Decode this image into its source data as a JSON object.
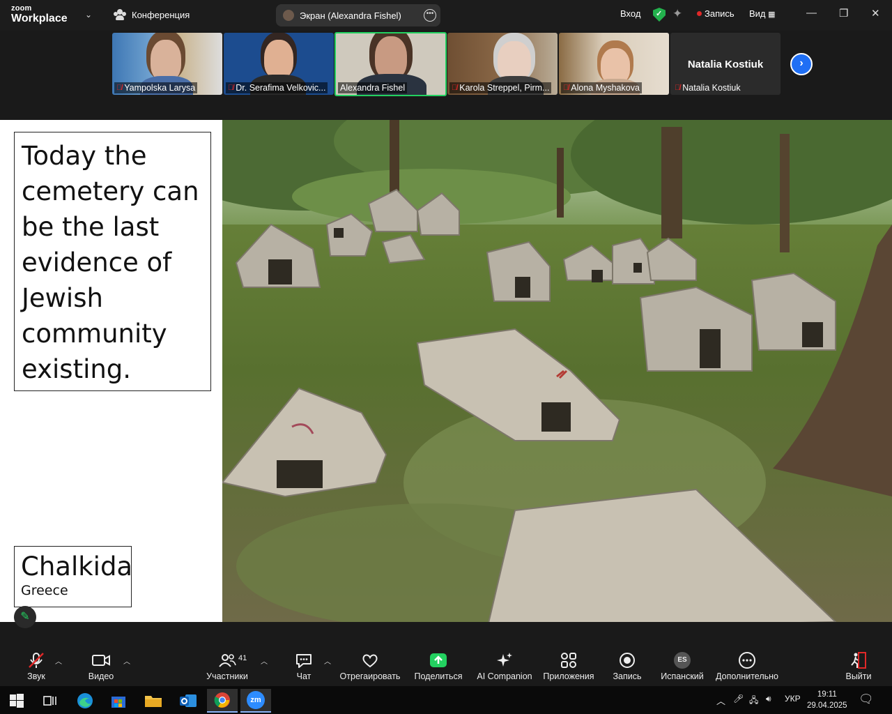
{
  "app": {
    "logo_top": "zoom",
    "logo_bottom": "Workplace",
    "conference_menu": "Конференция",
    "screen_share_label": "Экран (Alexandra Fishel)",
    "signin_label": "Вход",
    "record_status": "Запись",
    "view_label": "Вид"
  },
  "participants": [
    {
      "name": "Yampolska Larysa",
      "muted": true
    },
    {
      "name": "Dr. Serafima Velkovic...",
      "muted": true
    },
    {
      "name": "Alexandra Fishel",
      "muted": false
    },
    {
      "name": "Karola Streppel, Pirm...",
      "muted": true
    },
    {
      "name": "Alona Myshakova",
      "muted": true
    },
    {
      "name": "Natalia Kostiuk",
      "muted": true,
      "title": "Natalia Kostiuk"
    }
  ],
  "slide": {
    "body_text": "Today the cemetery can be the last evidence of Jewish community existing.",
    "location_city": "Chalkida",
    "location_country": "Greece"
  },
  "toolbar": {
    "audio": "Звук",
    "video": "Видео",
    "participants": "Участники",
    "participants_count": "41",
    "chat": "Чат",
    "react": "Отрегаировать",
    "share": "Поделиться",
    "ai": "AI Companion",
    "apps": "Приложения",
    "record": "Запись",
    "language": "Испанский",
    "language_badge": "ES",
    "more": "Дополнительно",
    "leave": "Выйти"
  },
  "taskbar": {
    "language": "УКР",
    "time": "19:11",
    "date": "29.04.2025",
    "zoom_label": "zm"
  },
  "colors": {
    "accent_green": "#23d160",
    "rec_red": "#e02828",
    "next_blue": "#1f6ff5",
    "leave_red": "#e02828"
  }
}
